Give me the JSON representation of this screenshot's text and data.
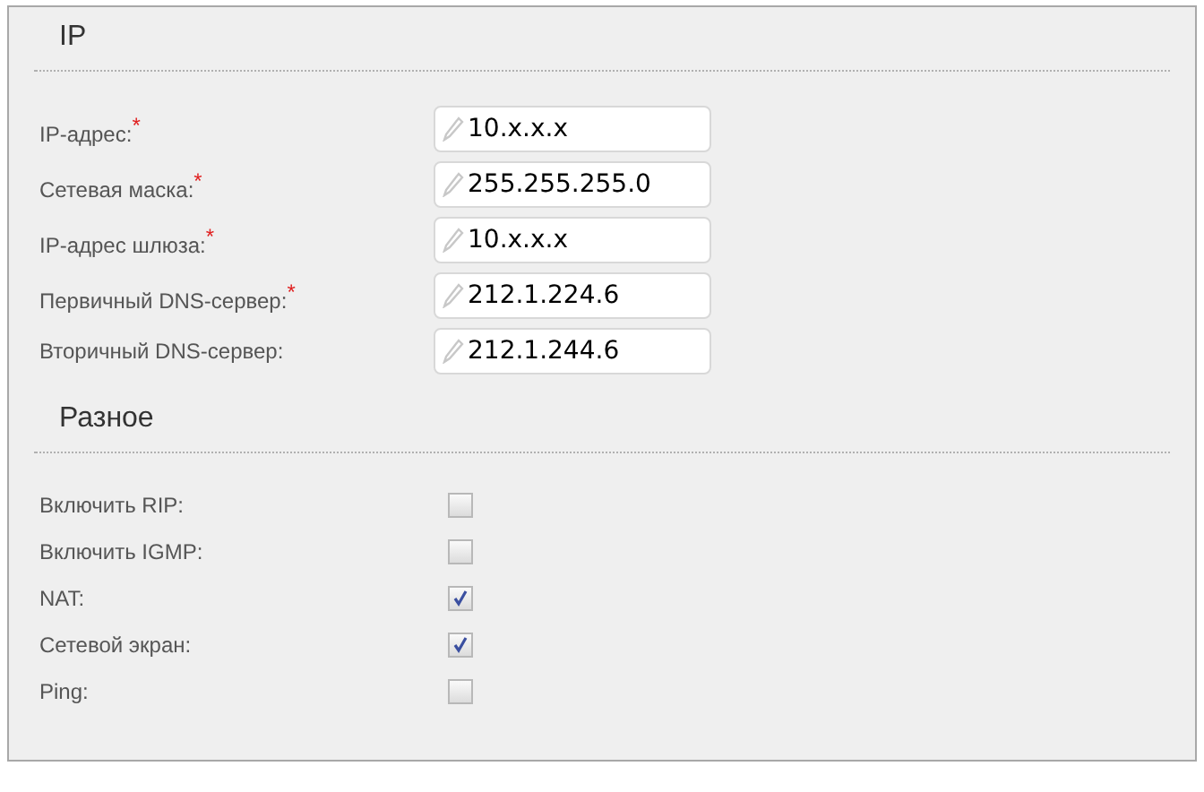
{
  "ip": {
    "title": "IP",
    "fields": [
      {
        "label": "IP-адрес:",
        "required": true,
        "value": "10.x.x.x"
      },
      {
        "label": "Сетевая маска:",
        "required": true,
        "value": "255.255.255.0"
      },
      {
        "label": "IP-адрес шлюза:",
        "required": true,
        "value": "10.x.x.x"
      },
      {
        "label": "Первичный DNS-сервер:",
        "required": true,
        "value": "212.1.224.6"
      },
      {
        "label": "Вторичный DNS-сервер:",
        "required": false,
        "value": "212.1.244.6"
      }
    ]
  },
  "misc": {
    "title": "Разное",
    "options": [
      {
        "label": "Включить RIP:",
        "checked": false
      },
      {
        "label": "Включить IGMP:",
        "checked": false
      },
      {
        "label": "NAT:",
        "checked": true
      },
      {
        "label": "Сетевой экран:",
        "checked": true
      },
      {
        "label": "Ping:",
        "checked": false
      }
    ]
  },
  "required_mark": "*"
}
